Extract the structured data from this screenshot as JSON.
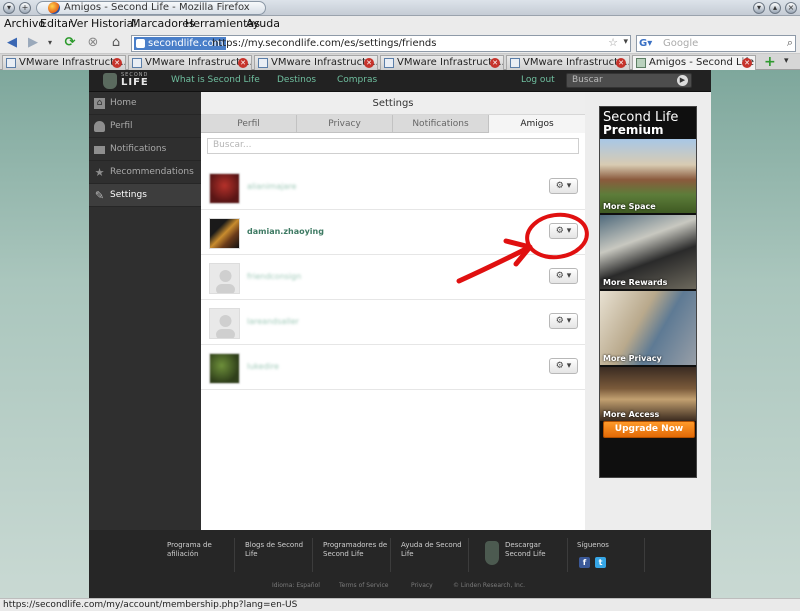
{
  "window": {
    "title": "Amigos - Second Life - Mozilla Firefox"
  },
  "menubar": [
    "Archivo",
    "Editar",
    "Ver",
    "Historial",
    "Marcadores",
    "Herramientas",
    "Ayuda"
  ],
  "navbar": {
    "site_identity": "secondlife.com",
    "url": "https://my.secondlife.com/es/settings/friends",
    "search_placeholder": "Google"
  },
  "tabs": [
    {
      "label": "VMware Infrastructu...",
      "active": false
    },
    {
      "label": "VMware Infrastructu...",
      "active": false
    },
    {
      "label": "VMware Infrastructu...",
      "active": false
    },
    {
      "label": "VMware Infrastructu...",
      "active": false
    },
    {
      "label": "VMware Infrastructu...",
      "active": false
    },
    {
      "label": "Amigos - Second Life",
      "active": true
    }
  ],
  "site_header": {
    "logo_small": "SECOND",
    "logo_text": "LIFE",
    "links": [
      "What is Second Life",
      "Destinos",
      "Compras",
      "Log out"
    ],
    "search_placeholder": "Buscar"
  },
  "left_nav": [
    {
      "label": "Home",
      "icon": "home-icon",
      "active": false
    },
    {
      "label": "Perfil",
      "icon": "person-icon",
      "active": false
    },
    {
      "label": "Notifications",
      "icon": "envelope-icon",
      "active": false
    },
    {
      "label": "Recommendations",
      "icon": "star-icon",
      "active": false
    },
    {
      "label": "Settings",
      "icon": "wrench-icon",
      "active": true
    }
  ],
  "settings": {
    "title": "Settings",
    "tabs": [
      {
        "label": "Perfil",
        "active": false
      },
      {
        "label": "Privacy",
        "active": false
      },
      {
        "label": "Notifications",
        "active": false
      },
      {
        "label": "Amigos",
        "active": true
      }
    ],
    "search_placeholder": "Buscar...",
    "friends": [
      {
        "name": "alianimajare",
        "blurred": true
      },
      {
        "name": "damian.zhaoying",
        "blurred": false
      },
      {
        "name": "friendconsign",
        "blurred": true
      },
      {
        "name": "lareandsaller",
        "blurred": true
      },
      {
        "name": "lukedire",
        "blurred": true
      }
    ],
    "gear_button_label": "⚙ ▾"
  },
  "ad": {
    "title_line1": "Second Life",
    "title_line2": "Premium",
    "panels": [
      "More Space",
      "More Rewards",
      "More Privacy",
      "More Access"
    ],
    "cta": "Upgrade Now"
  },
  "footer": {
    "columns": [
      "Programa de afiliación",
      "Blogs de Second Life",
      "Programadores de Second Life",
      "Ayuda de Second Life",
      "Descargar Second Life",
      "Síguenos"
    ],
    "bottom_links": [
      "Idioma: Español",
      "Terms of Service",
      "Privacy",
      "© Linden Research, Inc."
    ]
  },
  "statusbar": {
    "text": "https://secondlife.com/my/account/membership.php?lang=en-US"
  },
  "colors": {
    "accent_green": "#3e7a63",
    "annotation_red": "#e01010",
    "cta_orange": "#f08414"
  }
}
